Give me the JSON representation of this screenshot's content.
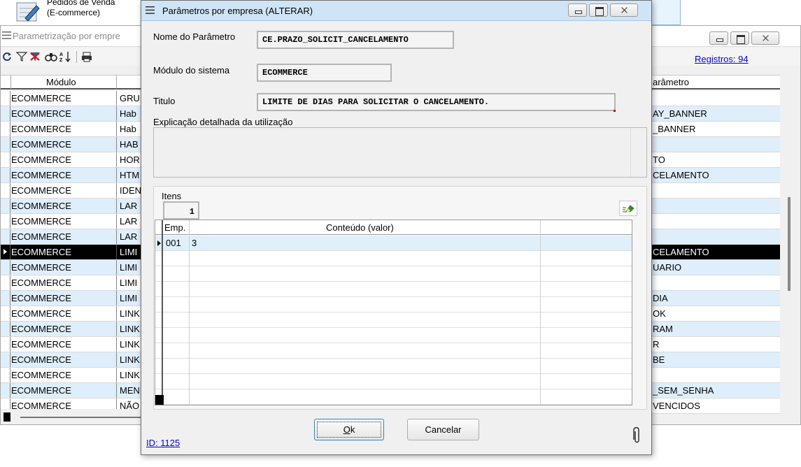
{
  "top_app": {
    "title_line1": "Pedidos de Venda",
    "title_line2": "(E-commerce)",
    "icon": "notepad-pen-icon"
  },
  "bg_window": {
    "title": "Parametrização por empre",
    "registros": "Registros: 94",
    "toolbar_icons": [
      "refresh-icon",
      "filter-icon",
      "clear-filter-icon",
      "binoculars-icon",
      "sort-az-icon",
      "print-icon"
    ],
    "columns": {
      "modulo": "Módulo",
      "parametro": "arâmetro"
    },
    "rows": [
      {
        "modulo": "ECOMMERCE",
        "desc": "GRU",
        "param": ""
      },
      {
        "modulo": "ECOMMERCE",
        "desc": "Hab",
        "param": "AY_BANNER"
      },
      {
        "modulo": "ECOMMERCE",
        "desc": "Hab",
        "param": "_BANNER"
      },
      {
        "modulo": "ECOMMERCE",
        "desc": "HAB",
        "param": ""
      },
      {
        "modulo": "ECOMMERCE",
        "desc": "HOR",
        "param": "TO"
      },
      {
        "modulo": "ECOMMERCE",
        "desc": "HTM",
        "param": "CELAMENTO"
      },
      {
        "modulo": "ECOMMERCE",
        "desc": "IDEN",
        "param": ""
      },
      {
        "modulo": "ECOMMERCE",
        "desc": "LAR",
        "param": ""
      },
      {
        "modulo": "ECOMMERCE",
        "desc": "LAR",
        "param": ""
      },
      {
        "modulo": "ECOMMERCE",
        "desc": "LAR",
        "param": ""
      },
      {
        "modulo": "ECOMMERCE",
        "desc": "LIMI",
        "param": "CELAMENTO"
      },
      {
        "modulo": "ECOMMERCE",
        "desc": "LIMI",
        "param": "UARIO"
      },
      {
        "modulo": "ECOMMERCE",
        "desc": "LIMI",
        "param": ""
      },
      {
        "modulo": "ECOMMERCE",
        "desc": "LIMI",
        "param": "DIA"
      },
      {
        "modulo": "ECOMMERCE",
        "desc": "LINK",
        "param": "OK"
      },
      {
        "modulo": "ECOMMERCE",
        "desc": "LINK",
        "param": "RAM"
      },
      {
        "modulo": "ECOMMERCE",
        "desc": "LINK",
        "param": "R"
      },
      {
        "modulo": "ECOMMERCE",
        "desc": "LINK",
        "param": "BE"
      },
      {
        "modulo": "ECOMMERCE",
        "desc": "LINK",
        "param": ""
      },
      {
        "modulo": "ECOMMERCE",
        "desc": "MEN",
        "param": "_SEM_SENHA"
      },
      {
        "modulo": "ECOMMERCE",
        "desc": "NÃO",
        "param": "VENCIDOS"
      }
    ],
    "selected_row_index": 10
  },
  "dialog": {
    "title": "Parâmetros por empresa (ALTERAR)",
    "nome_label": "Nome do Parâmetro",
    "nome_value": "CE.PRAZO_SOLICIT_CANCELAMENTO",
    "modulo_label": "Módulo do sistema",
    "modulo_value": "ECOMMERCE",
    "titulo_label": "Titulo",
    "titulo_value": "LIMITE DE DIAS PARA SOLICITAR O CANCELAMENTO.",
    "explicacao_label": "Explicação detalhada da utilização",
    "explicacao_value": "",
    "itens_label": "Itens",
    "itens_count": "1",
    "itens_btn_icon": "edit-eraser-icon",
    "grid_columns": {
      "emp": "Emp.",
      "conteudo": "Conteúdo (valor)"
    },
    "grid_rows": [
      {
        "emp": "001",
        "conteudo": "3"
      }
    ],
    "ok_underlined": "O",
    "ok_rest": "k",
    "cancel_label": "Cancelar",
    "id_text": "ID: 1125",
    "clip_icon": "paperclip-icon"
  },
  "colors": {
    "selection_bg": "#000000",
    "row_alt": "#dfeefb",
    "link": "#0000ee",
    "dialog_titlebar": "#cfe4f7"
  }
}
